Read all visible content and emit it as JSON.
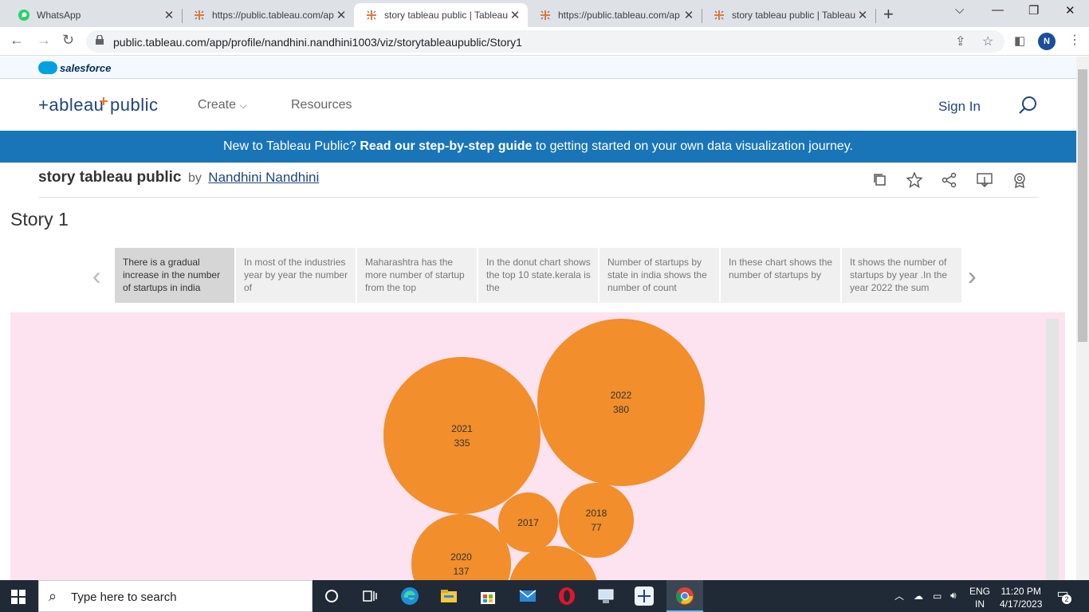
{
  "browser": {
    "tabs": [
      {
        "title": "WhatsApp",
        "icon": "whatsapp-icon"
      },
      {
        "title": "https://public.tableau.com/ap",
        "icon": "tableau-icon"
      },
      {
        "title": "story tableau public | Tableau",
        "icon": "tableau-icon"
      },
      {
        "title": "https://public.tableau.com/ap",
        "icon": "tableau-icon"
      },
      {
        "title": "story tableau public | Tableau",
        "icon": "tableau-icon"
      }
    ],
    "url": "public.tableau.com/app/profile/nandhini.nandhini1003/viz/storytableaupublic/Story1",
    "avatar_letter": "N"
  },
  "salesforce": {
    "label": "salesforce"
  },
  "header": {
    "brand": "+ableau public",
    "nav": {
      "create": "Create",
      "resources": "Resources"
    },
    "sign_in": "Sign In"
  },
  "banner": {
    "prefix": "New to Tableau Public? ",
    "link": "Read our step-by-step guide",
    "suffix": " to getting started on your own data visualization journey."
  },
  "viz": {
    "title": "story tableau public",
    "by": "by",
    "author": "Nandhini Nandhini"
  },
  "story": {
    "title": "Story 1",
    "points": [
      "There is a gradual increase in the number of startups in india",
      "In most of the industries year by year the number of",
      "Maharashtra has the more number of startup from the top",
      "In the donut chart shows the top 10 state.kerala is the",
      "Number of startups by state in india shows the number of count",
      "In these chart shows the number of startups by",
      "It shows the number of startups by year .In the year 2022 the sum"
    ]
  },
  "bubbles": [
    {
      "year": "2022",
      "value": "380"
    },
    {
      "year": "2021",
      "value": "335"
    },
    {
      "year": "2017",
      "value": ""
    },
    {
      "year": "2018",
      "value": "77"
    },
    {
      "year": "2020",
      "value": "137"
    },
    {
      "year": "",
      "value": ""
    }
  ],
  "taskbar": {
    "search_placeholder": "Type here to search",
    "lang_top": "ENG",
    "lang_bottom": "IN",
    "time": "11:20 PM",
    "date": "4/17/2023",
    "notifications": "2"
  },
  "colors": {
    "bubble": "#f28e2b",
    "viz_bg": "#fde2ef",
    "banner": "#1a75b8",
    "brand": "#1f457e"
  }
}
